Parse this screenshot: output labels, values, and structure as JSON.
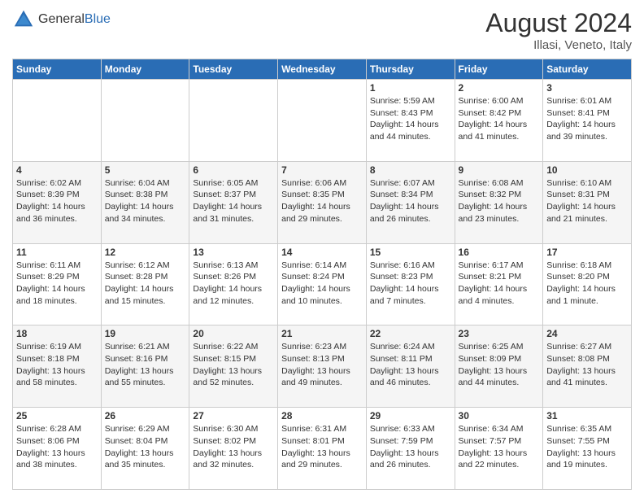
{
  "header": {
    "logo_general": "General",
    "logo_blue": "Blue",
    "month_year": "August 2024",
    "location": "Illasi, Veneto, Italy"
  },
  "days_of_week": [
    "Sunday",
    "Monday",
    "Tuesday",
    "Wednesday",
    "Thursday",
    "Friday",
    "Saturday"
  ],
  "weeks": [
    [
      {
        "day": "",
        "info": ""
      },
      {
        "day": "",
        "info": ""
      },
      {
        "day": "",
        "info": ""
      },
      {
        "day": "",
        "info": ""
      },
      {
        "day": "1",
        "info": "Sunrise: 5:59 AM\nSunset: 8:43 PM\nDaylight: 14 hours\nand 44 minutes."
      },
      {
        "day": "2",
        "info": "Sunrise: 6:00 AM\nSunset: 8:42 PM\nDaylight: 14 hours\nand 41 minutes."
      },
      {
        "day": "3",
        "info": "Sunrise: 6:01 AM\nSunset: 8:41 PM\nDaylight: 14 hours\nand 39 minutes."
      }
    ],
    [
      {
        "day": "4",
        "info": "Sunrise: 6:02 AM\nSunset: 8:39 PM\nDaylight: 14 hours\nand 36 minutes."
      },
      {
        "day": "5",
        "info": "Sunrise: 6:04 AM\nSunset: 8:38 PM\nDaylight: 14 hours\nand 34 minutes."
      },
      {
        "day": "6",
        "info": "Sunrise: 6:05 AM\nSunset: 8:37 PM\nDaylight: 14 hours\nand 31 minutes."
      },
      {
        "day": "7",
        "info": "Sunrise: 6:06 AM\nSunset: 8:35 PM\nDaylight: 14 hours\nand 29 minutes."
      },
      {
        "day": "8",
        "info": "Sunrise: 6:07 AM\nSunset: 8:34 PM\nDaylight: 14 hours\nand 26 minutes."
      },
      {
        "day": "9",
        "info": "Sunrise: 6:08 AM\nSunset: 8:32 PM\nDaylight: 14 hours\nand 23 minutes."
      },
      {
        "day": "10",
        "info": "Sunrise: 6:10 AM\nSunset: 8:31 PM\nDaylight: 14 hours\nand 21 minutes."
      }
    ],
    [
      {
        "day": "11",
        "info": "Sunrise: 6:11 AM\nSunset: 8:29 PM\nDaylight: 14 hours\nand 18 minutes."
      },
      {
        "day": "12",
        "info": "Sunrise: 6:12 AM\nSunset: 8:28 PM\nDaylight: 14 hours\nand 15 minutes."
      },
      {
        "day": "13",
        "info": "Sunrise: 6:13 AM\nSunset: 8:26 PM\nDaylight: 14 hours\nand 12 minutes."
      },
      {
        "day": "14",
        "info": "Sunrise: 6:14 AM\nSunset: 8:24 PM\nDaylight: 14 hours\nand 10 minutes."
      },
      {
        "day": "15",
        "info": "Sunrise: 6:16 AM\nSunset: 8:23 PM\nDaylight: 14 hours\nand 7 minutes."
      },
      {
        "day": "16",
        "info": "Sunrise: 6:17 AM\nSunset: 8:21 PM\nDaylight: 14 hours\nand 4 minutes."
      },
      {
        "day": "17",
        "info": "Sunrise: 6:18 AM\nSunset: 8:20 PM\nDaylight: 14 hours\nand 1 minute."
      }
    ],
    [
      {
        "day": "18",
        "info": "Sunrise: 6:19 AM\nSunset: 8:18 PM\nDaylight: 13 hours\nand 58 minutes."
      },
      {
        "day": "19",
        "info": "Sunrise: 6:21 AM\nSunset: 8:16 PM\nDaylight: 13 hours\nand 55 minutes."
      },
      {
        "day": "20",
        "info": "Sunrise: 6:22 AM\nSunset: 8:15 PM\nDaylight: 13 hours\nand 52 minutes."
      },
      {
        "day": "21",
        "info": "Sunrise: 6:23 AM\nSunset: 8:13 PM\nDaylight: 13 hours\nand 49 minutes."
      },
      {
        "day": "22",
        "info": "Sunrise: 6:24 AM\nSunset: 8:11 PM\nDaylight: 13 hours\nand 46 minutes."
      },
      {
        "day": "23",
        "info": "Sunrise: 6:25 AM\nSunset: 8:09 PM\nDaylight: 13 hours\nand 44 minutes."
      },
      {
        "day": "24",
        "info": "Sunrise: 6:27 AM\nSunset: 8:08 PM\nDaylight: 13 hours\nand 41 minutes."
      }
    ],
    [
      {
        "day": "25",
        "info": "Sunrise: 6:28 AM\nSunset: 8:06 PM\nDaylight: 13 hours\nand 38 minutes."
      },
      {
        "day": "26",
        "info": "Sunrise: 6:29 AM\nSunset: 8:04 PM\nDaylight: 13 hours\nand 35 minutes."
      },
      {
        "day": "27",
        "info": "Sunrise: 6:30 AM\nSunset: 8:02 PM\nDaylight: 13 hours\nand 32 minutes."
      },
      {
        "day": "28",
        "info": "Sunrise: 6:31 AM\nSunset: 8:01 PM\nDaylight: 13 hours\nand 29 minutes."
      },
      {
        "day": "29",
        "info": "Sunrise: 6:33 AM\nSunset: 7:59 PM\nDaylight: 13 hours\nand 26 minutes."
      },
      {
        "day": "30",
        "info": "Sunrise: 6:34 AM\nSunset: 7:57 PM\nDaylight: 13 hours\nand 22 minutes."
      },
      {
        "day": "31",
        "info": "Sunrise: 6:35 AM\nSunset: 7:55 PM\nDaylight: 13 hours\nand 19 minutes."
      }
    ]
  ]
}
